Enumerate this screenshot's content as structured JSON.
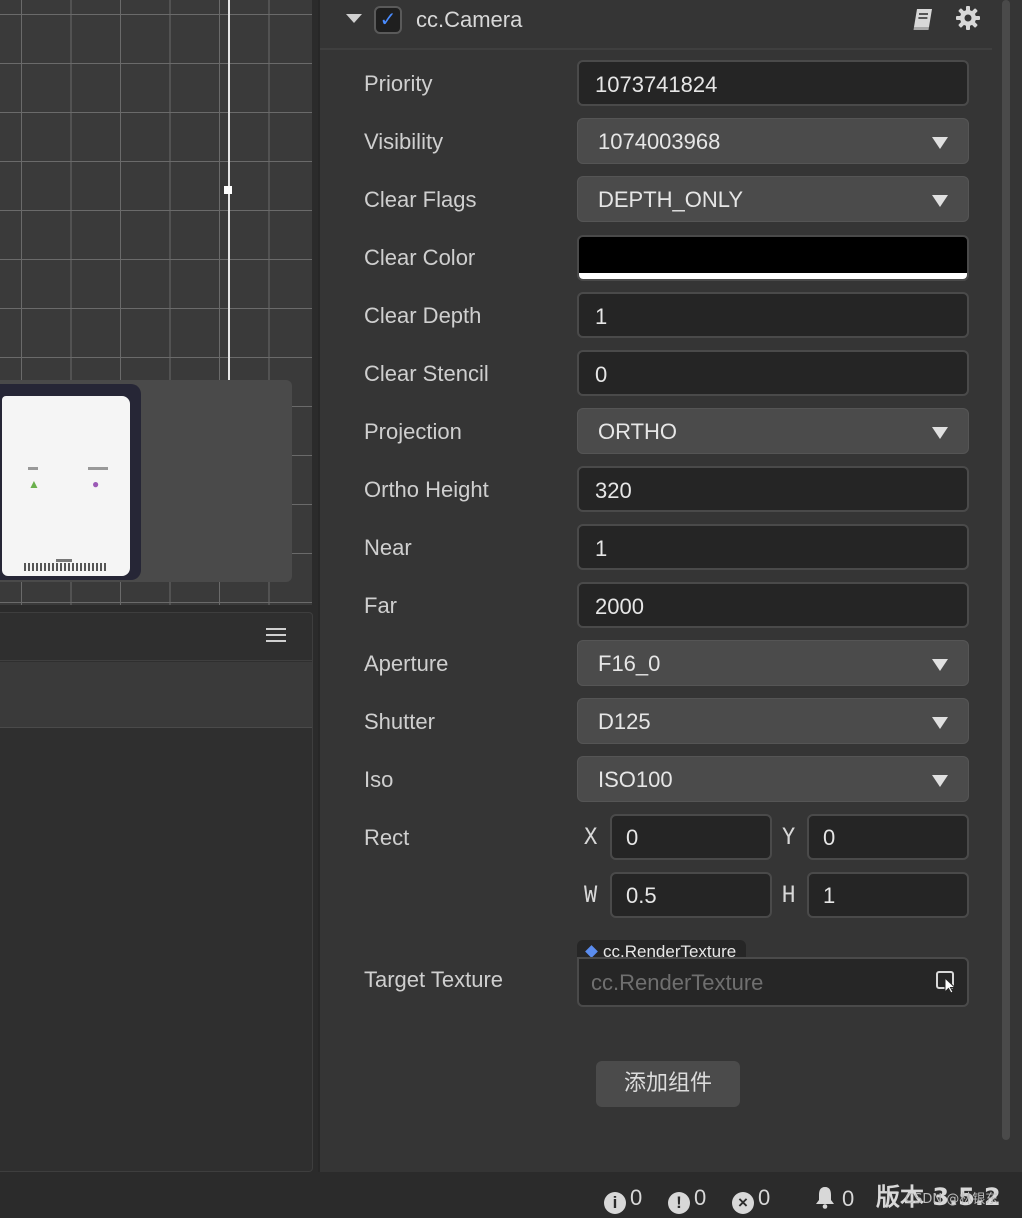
{
  "component": {
    "title": "cc.Camera",
    "enabled": true,
    "icons": [
      "collapse-arrow",
      "checkbox",
      "book-icon",
      "gear-icon"
    ]
  },
  "properties": {
    "priority": {
      "label": "Priority",
      "value": "1073741824"
    },
    "visibility": {
      "label": "Visibility",
      "value": "1074003968"
    },
    "clear_flags": {
      "label": "Clear Flags",
      "value": "DEPTH_ONLY"
    },
    "clear_color": {
      "label": "Clear Color",
      "color": "#000000",
      "alpha_color": "#ffffff"
    },
    "clear_depth": {
      "label": "Clear Depth",
      "value": "1"
    },
    "clear_stencil": {
      "label": "Clear Stencil",
      "value": "0"
    },
    "projection": {
      "label": "Projection",
      "value": "ORTHO"
    },
    "ortho_height": {
      "label": "Ortho Height",
      "value": "320"
    },
    "near": {
      "label": "Near",
      "value": "1"
    },
    "far": {
      "label": "Far",
      "value": "2000"
    },
    "aperture": {
      "label": "Aperture",
      "value": "F16_0"
    },
    "shutter": {
      "label": "Shutter",
      "value": "D125"
    },
    "iso": {
      "label": "Iso",
      "value": "ISO100"
    },
    "rect": {
      "label": "Rect",
      "x_label": "X",
      "x": "0",
      "y_label": "Y",
      "y": "0",
      "w_label": "W",
      "w": "0.5",
      "h_label": "H",
      "h": "1"
    },
    "target_texture": {
      "label": "Target Texture",
      "type_tag": "cc.RenderTexture",
      "placeholder": "cc.RenderTexture"
    }
  },
  "add_component_label": "添加组件",
  "status_bar": {
    "info_count": "0",
    "warning_count": "0",
    "error_count": "0",
    "notification_count": "0",
    "version": "版本 3.5.2"
  },
  "watermark": "CSDN @林银东",
  "colors": {
    "accent": "#4a8cff",
    "panel_bg": "#353535",
    "input_bg": "#252525",
    "select_bg": "#4b4b4b"
  }
}
